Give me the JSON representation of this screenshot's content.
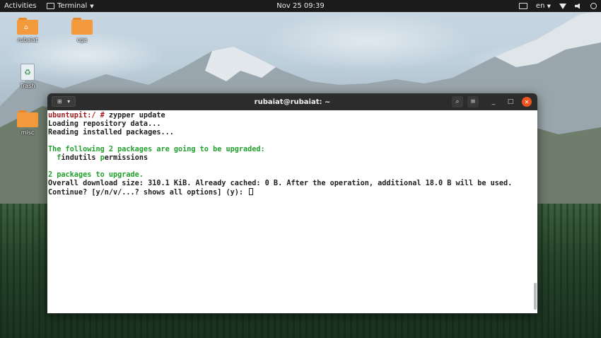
{
  "topbar": {
    "activities": "Activities",
    "app_name": "Terminal",
    "clock": "Nov 25  09:39",
    "language": "en"
  },
  "desktop": {
    "icons": [
      {
        "label": "rubaiat"
      },
      {
        "label": "cga"
      },
      {
        "label": "Trash"
      },
      {
        "label": "misc"
      }
    ]
  },
  "terminal": {
    "title": "rubaiat@rubaiat: ~",
    "prompt": "ubuntupit:/ #",
    "command": " zypper update",
    "lines": {
      "l1": "Loading repository data...",
      "l2": "Reading installed packages...",
      "l3": "The following 2 packages are going to be upgraded:",
      "pkg1_first": "f",
      "pkg1_rest": "indutils ",
      "pkg2_first": "p",
      "pkg2_rest": "ermissions",
      "l5": "2 packages to upgrade.",
      "l6": "Overall download size: 310.1 KiB. Already cached: 0 B. After the operation, additional 18.0 B will be used.",
      "l7": "Continue? [y/n/v/...? shows all options] (y): "
    }
  },
  "colors": {
    "prompt": "#a1191c",
    "green": "#22a02c",
    "close": "#e95420",
    "folder": "#f39a3c"
  }
}
